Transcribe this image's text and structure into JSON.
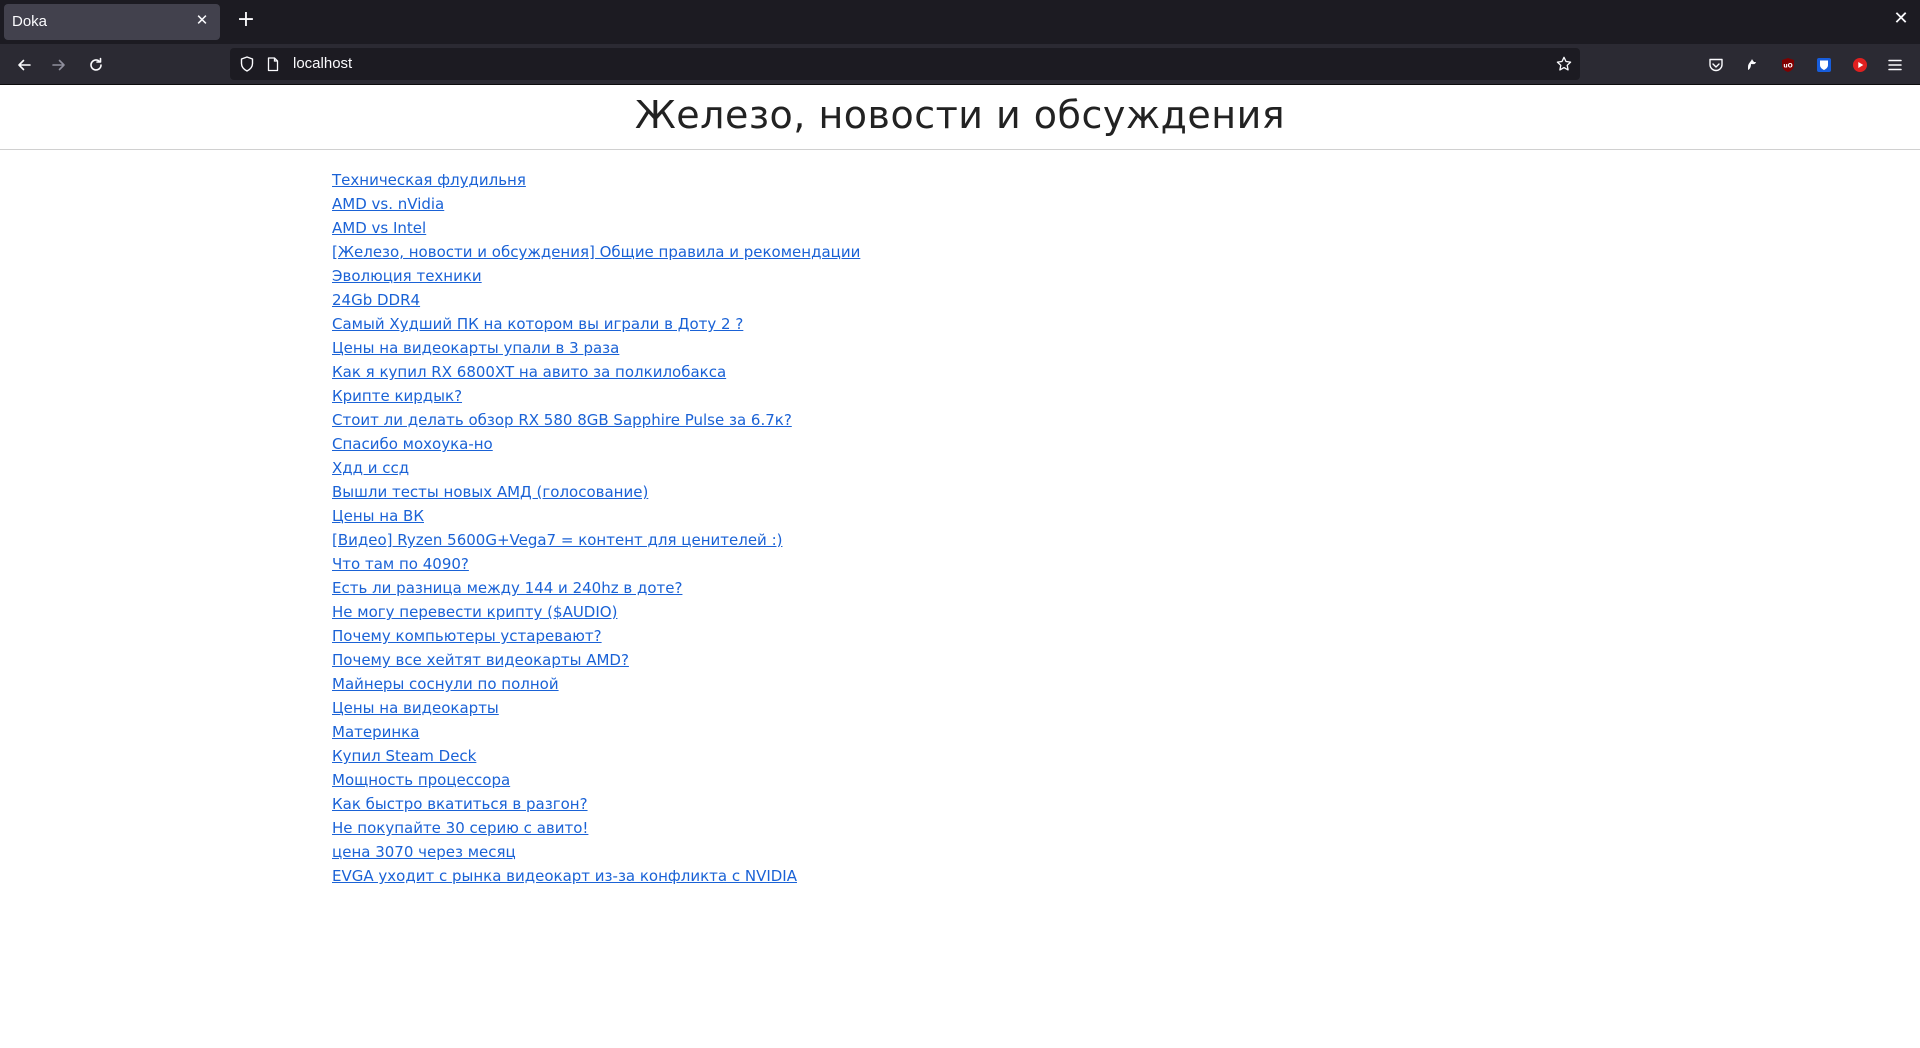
{
  "browser": {
    "tab_title": "Doka",
    "tab_close": "✕",
    "new_tab": "+",
    "window_close": "✕",
    "url": "localhost"
  },
  "page": {
    "title": "Железо, новости и обсуждения",
    "topics": [
      "Техническая флудильня",
      "AMD vs. nVidia",
      "AMD vs Intel",
      "[Железо, новости и обсуждения] Общие правила и рекомендации",
      "Эволюция техники",
      "24Gb DDR4",
      "Самый Худший ПК на котором вы играли в Доту 2 ?",
      "Цены на видеокарты упали в 3 раза",
      "Как я купил RX 6800XT на авито за полкилобакса",
      "Крипте кирдык?",
      "Стоит ли делать обзор RX 580 8GB Sapphire Pulse за 6.7к?",
      "Спасибо мохоука-но",
      "Хдд и ссд",
      "Вышли тесты новых АМД (голосование)",
      "Цены на ВК",
      "[Видео] Ryzen 5600G+Vega7 = контент для ценителей :)",
      "Что там по 4090?",
      "Есть ли разница между 144 и 240hz в доте?",
      "Не могу перевести крипту ($AUDIO)",
      "Почему компьютеры устаревают?",
      "Почему все хейтят видеокарты AMD?",
      "Майнеры соснули по полной",
      "Цены на видеокарты",
      "Материнка",
      "Купил Steam Deck",
      "Мощность процессора",
      "Как быстро вкатиться в разгон?",
      "Не покупайте 30 серию с авито!",
      "цена 3070 через месяц",
      "EVGA уходит с рынка видеокарт из-за конфликта с NVIDIA"
    ]
  }
}
